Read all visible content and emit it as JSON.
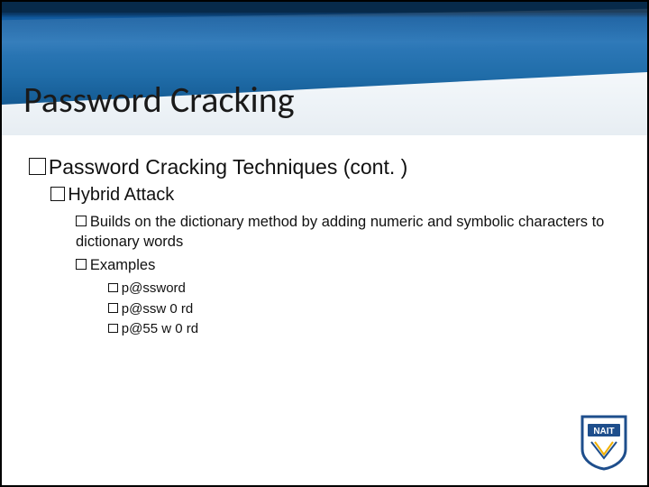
{
  "title": "Password Cracking",
  "l1": "Password Cracking Techniques (cont. )",
  "l2": "Hybrid Attack",
  "l3_a": "Builds on the dictionary method by adding numeric and symbolic characters to dictionary words",
  "l3_b": "Examples",
  "examples": {
    "0": "p@ssword",
    "1": "p@ssw 0 rd",
    "2": "p@55 w 0 rd"
  },
  "logo_text": "NAIT"
}
